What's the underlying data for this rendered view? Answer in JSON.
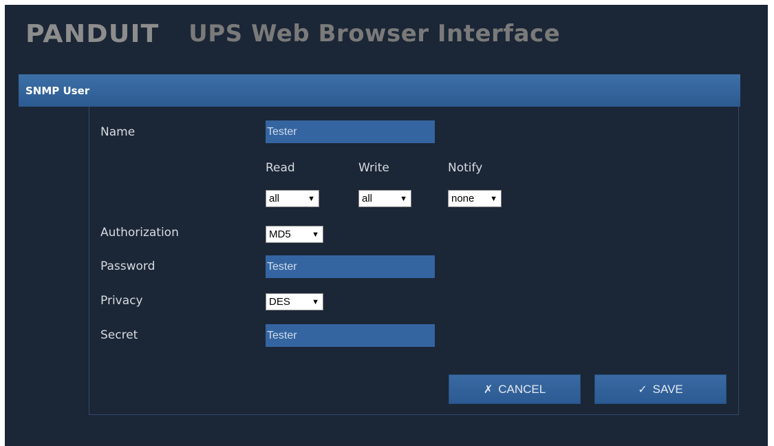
{
  "header": {
    "logo_text": "PANDUIT",
    "title": "UPS Web Browser Interface"
  },
  "section": {
    "title": "SNMP User"
  },
  "form": {
    "name_label": "Name",
    "name_value": "Tester",
    "read_label": "Read",
    "write_label": "Write",
    "notify_label": "Notify",
    "read_value": "all",
    "write_value": "all",
    "notify_value": "none",
    "authorization_label": "Authorization",
    "authorization_value": "MD5",
    "password_label": "Password",
    "password_value": "Tester",
    "privacy_label": "Privacy",
    "privacy_value": "DES",
    "secret_label": "Secret",
    "secret_value": "Tester"
  },
  "buttons": {
    "cancel_icon": "✗",
    "cancel_label": "CANCEL",
    "save_icon": "✓",
    "save_label": "SAVE"
  },
  "colors": {
    "background": "#1b2636",
    "section_bar": "#3465a0",
    "input_fill": "#3465a0",
    "header_text": "#7a7a7a"
  }
}
